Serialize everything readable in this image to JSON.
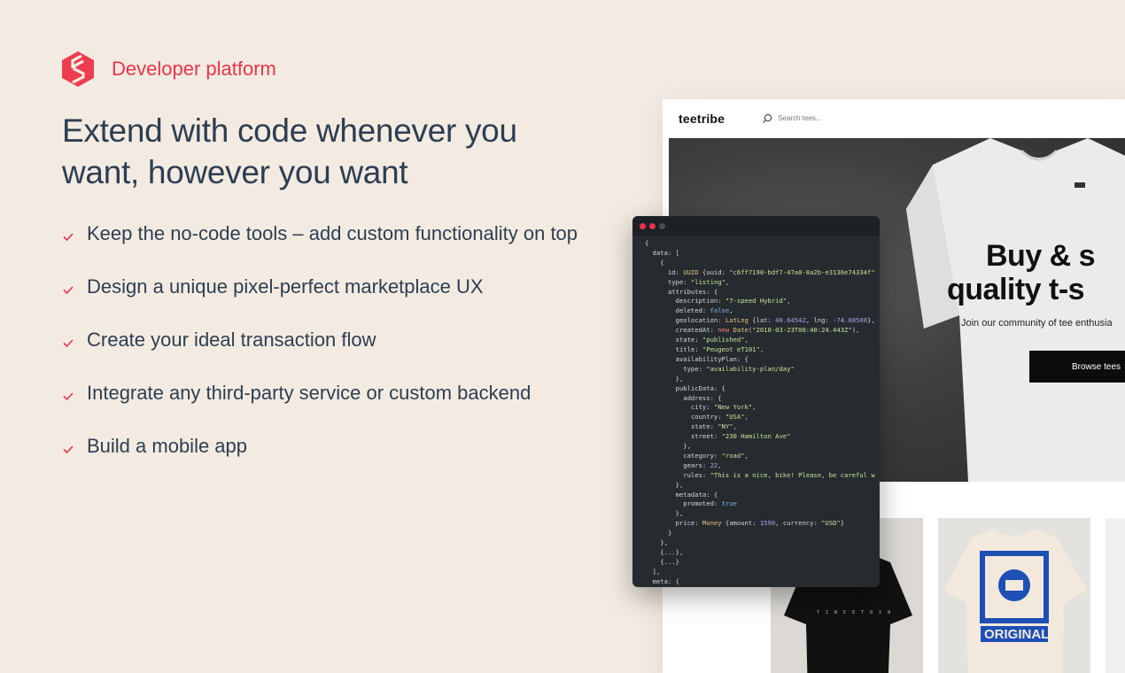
{
  "brand": {
    "text": "Developer platform",
    "color": "#e9344a",
    "logo_icon": "sharetribe-logo-icon"
  },
  "headline": "Extend with code whenever you want, however you want",
  "features": [
    "Keep the no-code tools – add custom functionality on top",
    "Design a unique pixel-perfect marketplace UX",
    "Create your ideal transaction flow",
    "Integrate any third-party service or custom backend",
    "Build a mobile app"
  ],
  "store": {
    "logo": "teetribe",
    "search_placeholder": "Search tees...",
    "hero_line1": "Buy & s",
    "hero_line2": "quality t-s",
    "hero_sub": "Join our community of tee enthusia",
    "hero_button": "Browse tees",
    "card_badge": "ORIGINAL"
  },
  "code": {
    "lines": [
      "{",
      "  data: [",
      "    {",
      "      id: UUID {uuid: \"c6ff7190-bdf7-47a0-8a2b-e3136e74334f\"",
      "      type: \"listing\",",
      "      attributes: {",
      "        description: \"7-speed Hybrid\",",
      "        deleted: false,",
      "        geolocation: LatLng {lat: 40.64542, lng: -74.08508},",
      "        createdAt: new Date(\"2018-03-23T08:40:24.443Z\"),",
      "        state: \"published\",",
      "        title: \"Peugeot eT101\",",
      "        availabilityPlan: {",
      "          type: \"availability-plan/day\"",
      "        },",
      "        publicData: {",
      "          address: {",
      "            city: \"New York\",",
      "            country: \"USA\",",
      "            state: \"NY\",",
      "            street: \"230 Hamilton Ave\"",
      "          },",
      "          category: \"road\",",
      "          gears: 22,",
      "          rules: \"This is a nice, bike! Please, be careful w",
      "        },",
      "        metadata: {",
      "          promoted: true",
      "        },",
      "        price: Money {amount: 1590, currency: \"USD\"}",
      "      }",
      "    },",
      "    {...},",
      "    {...}",
      "  ],",
      "  meta: {"
    ]
  },
  "colors": {
    "background": "#f3ebe2",
    "accent": "#e9344a",
    "text": "#2d3e52",
    "editor_bg": "#262b30"
  }
}
